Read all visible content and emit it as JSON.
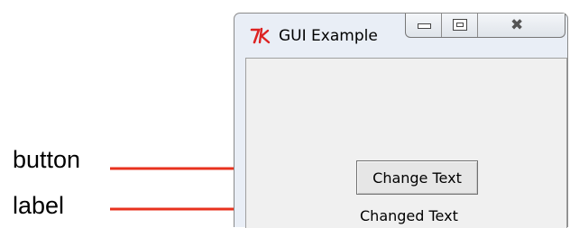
{
  "annotations": {
    "button_label": "button",
    "label_label": "label",
    "arrow_color": "#e8321e"
  },
  "window": {
    "title": "GUI Example",
    "app_icon": "tk-feather-icon",
    "controls": {
      "minimize": "minimize-icon",
      "maximize": "maximize-icon",
      "close": "close-icon"
    }
  },
  "content": {
    "button_text": "Change Text",
    "label_text": "Changed Text"
  }
}
